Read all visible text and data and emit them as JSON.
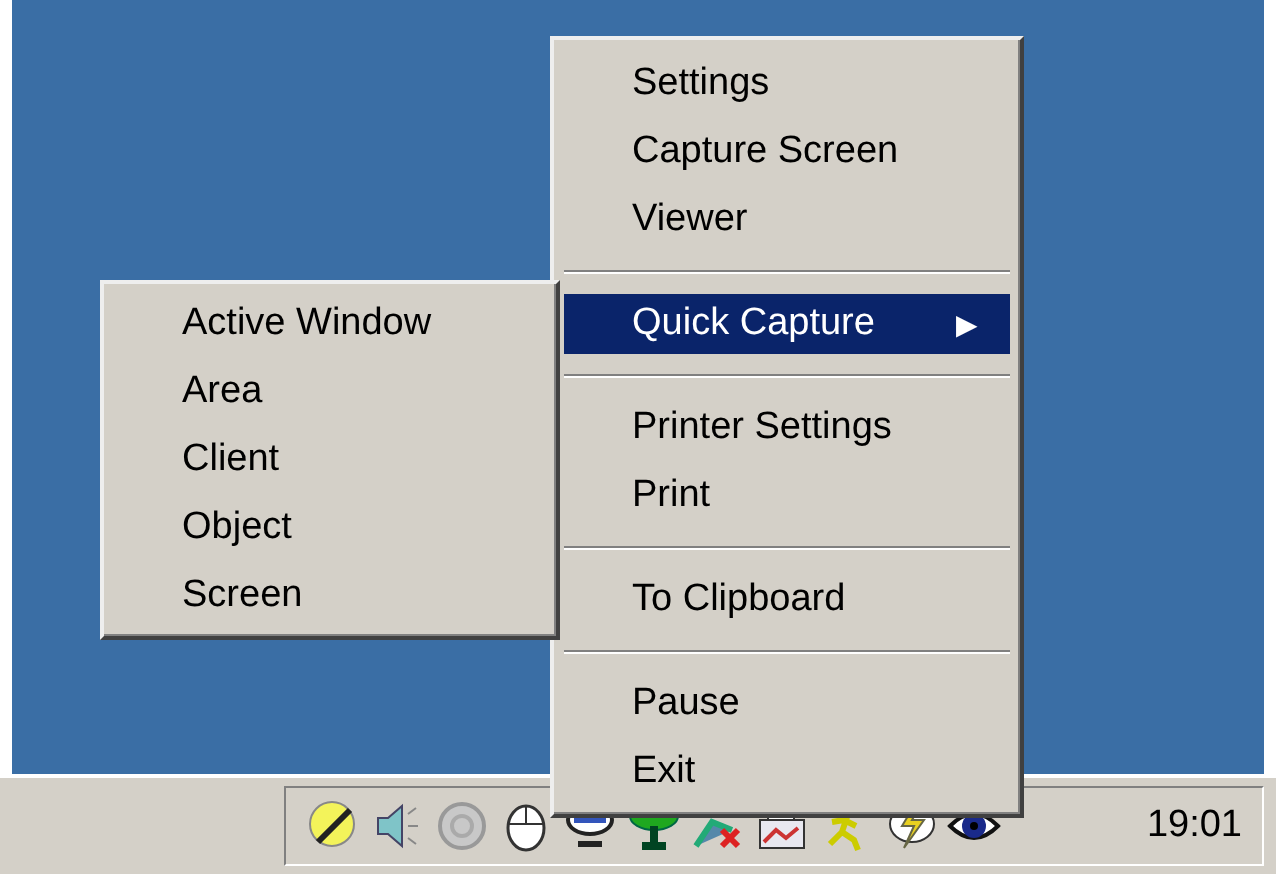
{
  "context_menu": {
    "items": [
      {
        "kind": "item",
        "label": "Settings",
        "selected": false
      },
      {
        "kind": "item",
        "label": "Capture Screen",
        "selected": false
      },
      {
        "kind": "item",
        "label": "Viewer",
        "selected": false
      },
      {
        "kind": "separator"
      },
      {
        "kind": "submenu",
        "label": "Quick Capture",
        "selected": true,
        "arrow": "▶"
      },
      {
        "kind": "separator"
      },
      {
        "kind": "item",
        "label": "Printer Settings",
        "selected": false
      },
      {
        "kind": "item",
        "label": "Print",
        "selected": false
      },
      {
        "kind": "separator"
      },
      {
        "kind": "item",
        "label": "To Clipboard",
        "selected": false
      },
      {
        "kind": "separator"
      },
      {
        "kind": "item",
        "label": "Pause",
        "selected": false
      },
      {
        "kind": "item",
        "label": "Exit",
        "selected": false
      }
    ]
  },
  "submenu": {
    "items": [
      {
        "label": "Active Window",
        "selected": false
      },
      {
        "label": "Area",
        "selected": false
      },
      {
        "label": "Client",
        "selected": false
      },
      {
        "label": "Object",
        "selected": false
      },
      {
        "label": "Screen",
        "selected": false
      }
    ]
  },
  "taskbar": {
    "clock": "19:01"
  }
}
